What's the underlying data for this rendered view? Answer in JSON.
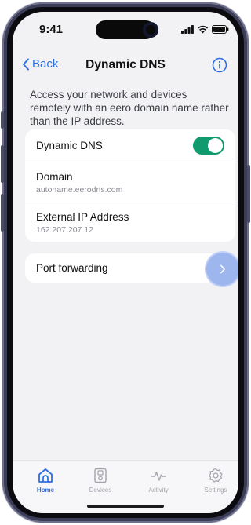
{
  "status_bar": {
    "time": "9:41"
  },
  "nav": {
    "back_label": "Back",
    "title": "Dynamic DNS",
    "info_icon": "info-icon"
  },
  "description": "Access your network and devices remotely with an eero domain name rather than the IP address.",
  "dns_card": {
    "toggle_label": "Dynamic DNS",
    "toggle_on": true,
    "domain_label": "Domain",
    "domain_value": "autoname.eerodns.com",
    "ip_label": "External IP Address",
    "ip_value": "162.207.207.12"
  },
  "port_forwarding": {
    "label": "Port forwarding"
  },
  "tabs": [
    {
      "label": "Home",
      "icon": "home-icon",
      "active": true
    },
    {
      "label": "Devices",
      "icon": "devices-icon",
      "active": false
    },
    {
      "label": "Activity",
      "icon": "activity-icon",
      "active": false
    },
    {
      "label": "Settings",
      "icon": "settings-icon",
      "active": false
    }
  ],
  "colors": {
    "accent": "#2f6fe4",
    "toggle_on": "#109a6e",
    "background": "#f2f2f4"
  }
}
